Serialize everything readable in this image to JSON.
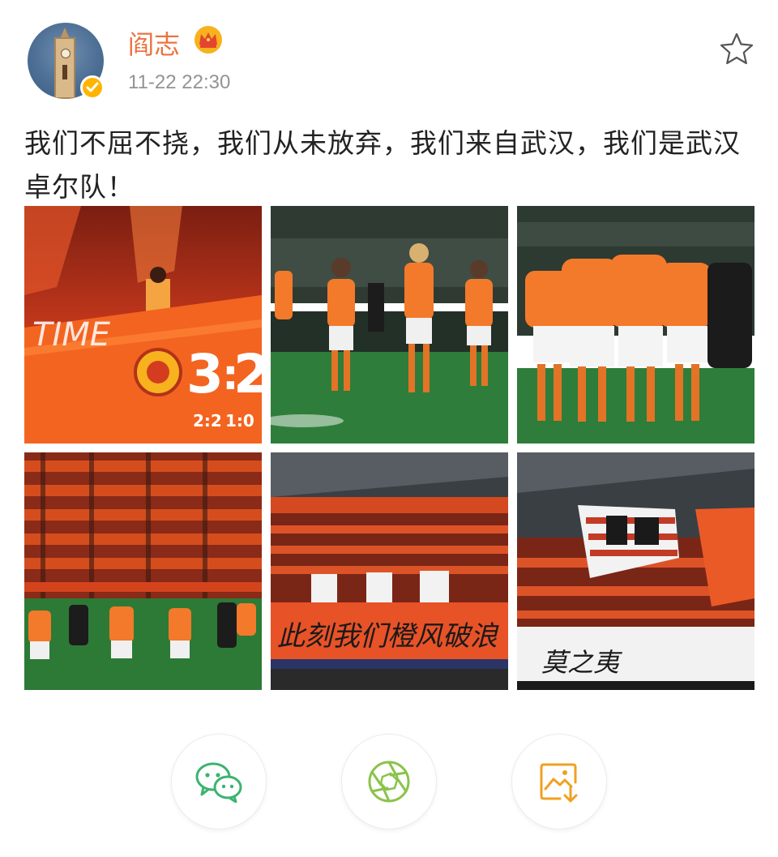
{
  "post": {
    "author": "阎志",
    "time": "11-22 22:30",
    "text": "我们不屈不挠，我们从未放弃，我们来自武汉，我们是武汉卓尔队！"
  },
  "photos": [
    {
      "name": "scoreboard-photo",
      "home_score": "3",
      "away_score": "2",
      "sub_left": "2:2",
      "sub_right": "1:0",
      "banner": "TIME"
    },
    {
      "name": "players-celebrating-photo"
    },
    {
      "name": "team-huddle-photo"
    },
    {
      "name": "fans-stands-photo"
    },
    {
      "name": "fans-banner-photo",
      "banner": "此刻我们橙风破浪"
    },
    {
      "name": "fans-flags-photo",
      "banner": "莫之夷"
    }
  ],
  "share": [
    {
      "name": "wechat-share-button",
      "icon": "wechat-icon",
      "color": "#3cb371"
    },
    {
      "name": "moments-share-button",
      "icon": "moments-aperture-icon",
      "color": "#8bc34a"
    },
    {
      "name": "save-image-button",
      "icon": "save-image-icon",
      "color": "#f0a020"
    }
  ],
  "colors": {
    "username": "#eb7340",
    "timestamp": "#939393",
    "team_orange": "#f26a21",
    "verified": "#ffb400"
  }
}
